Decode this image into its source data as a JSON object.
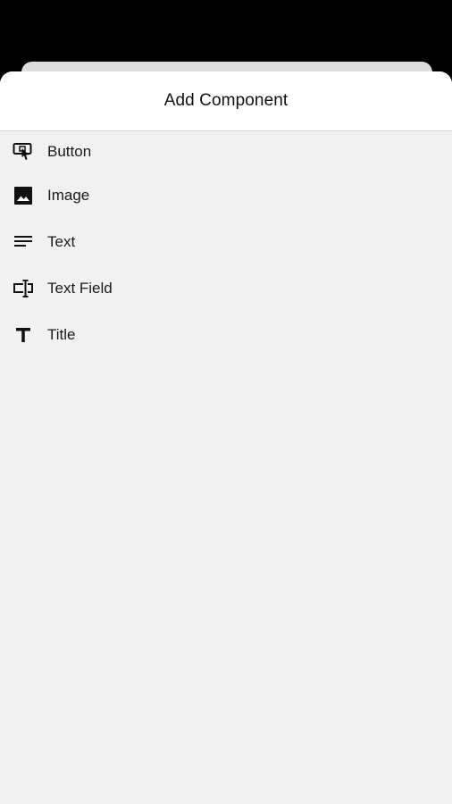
{
  "sheet": {
    "title": "Add Component"
  },
  "components": [
    {
      "label": "Button",
      "icon": "touch-button-icon"
    },
    {
      "label": "Image",
      "icon": "image-icon"
    },
    {
      "label": "Text",
      "icon": "text-lines-icon"
    },
    {
      "label": "Text Field",
      "icon": "text-field-icon"
    },
    {
      "label": "Title",
      "icon": "title-icon"
    }
  ],
  "colors": {
    "backdrop": "#000000",
    "sheet_background": "#f1f1f1",
    "header_background": "#ffffff",
    "text": "#111111"
  }
}
